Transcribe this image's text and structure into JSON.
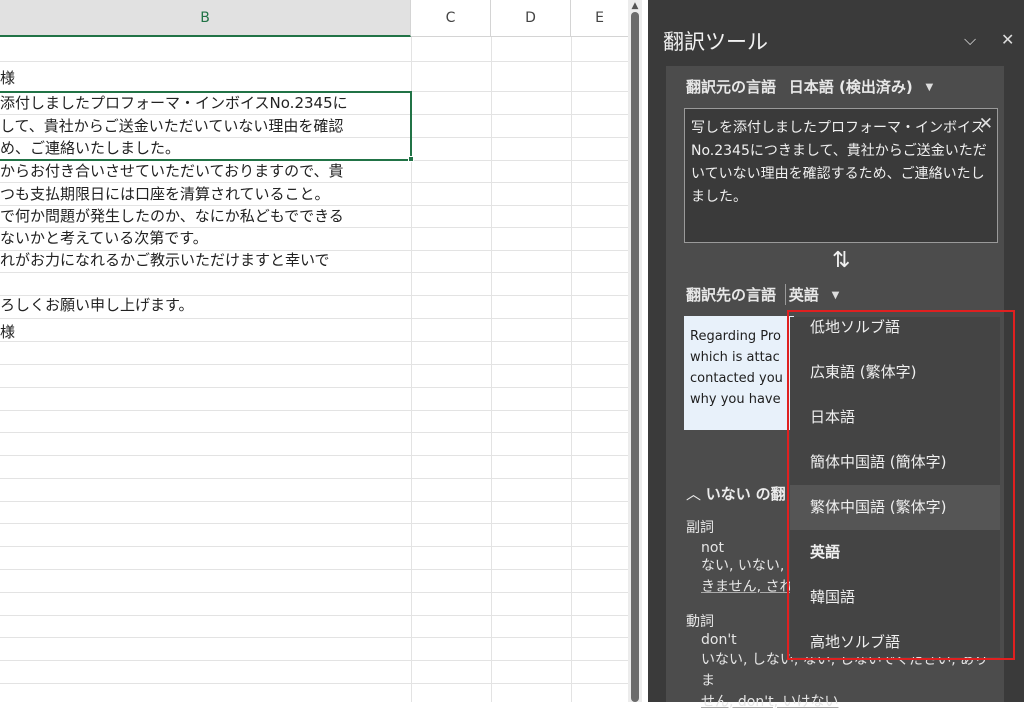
{
  "sheet": {
    "columns": [
      "B",
      "C",
      "D",
      "E"
    ],
    "rows": [
      "",
      "様",
      "添付しましたプロフォーマ・インボイスNo.2345に",
      "して、貴社からご送金いただいていない理由を確認",
      "め、ご連絡いたしました。",
      "からお付き合いさせていただいておりますので、貴",
      "つも支払期限日には口座を清算されていること。",
      "で何か問題が発生したのか、なにか私どもでできる",
      "ないかと考えている次第です。",
      "れがお力になれるかご教示いただけますと幸いで",
      "",
      "ろしくお願い申し上げます。",
      "様"
    ]
  },
  "pane": {
    "title": "翻訳ツール",
    "collapse_icon": "chevron-down-icon",
    "close_icon": "close-icon",
    "source_label": "翻訳元の言語",
    "source_lang": "日本語 (検出済み)",
    "source_text": "写しを添付しましたプロフォーマ・インボイスNo.2345につきまして、貴社からご送金いただいていない理由を確認するため、ご連絡いたしました。",
    "target_label": "翻訳先の言語",
    "target_lang": "英語",
    "target_text_lines": [
      "Regarding Pro",
      "which is attac",
      "contacted you",
      "why you have"
    ],
    "dict_word": "いない",
    "dict_head_suffix": "の翻",
    "dict_entries": [
      {
        "pos": "副詞",
        "word": "not",
        "syn1": "ない, いない, あ",
        "syn2": "きません, されま"
      },
      {
        "pos": "動詞",
        "word": "don't",
        "syn1": "いない, しない, ない, しないでください, ありま",
        "syn2": "せん, don't, いけない"
      }
    ]
  },
  "dropdown": {
    "items": [
      "低地ソルブ語",
      "広東語 (繁体字)",
      "日本語",
      "簡体中国語 (簡体字)",
      "繁体中国語 (繁体字)",
      "英語",
      "韓国語",
      "高地ソルブ語"
    ],
    "hovered": "繁体中国語 (繁体字)",
    "selected": "英語"
  },
  "colors": {
    "accent": "#217346",
    "pane_bg": "#3a3a3a",
    "highlight": "#e02020"
  }
}
